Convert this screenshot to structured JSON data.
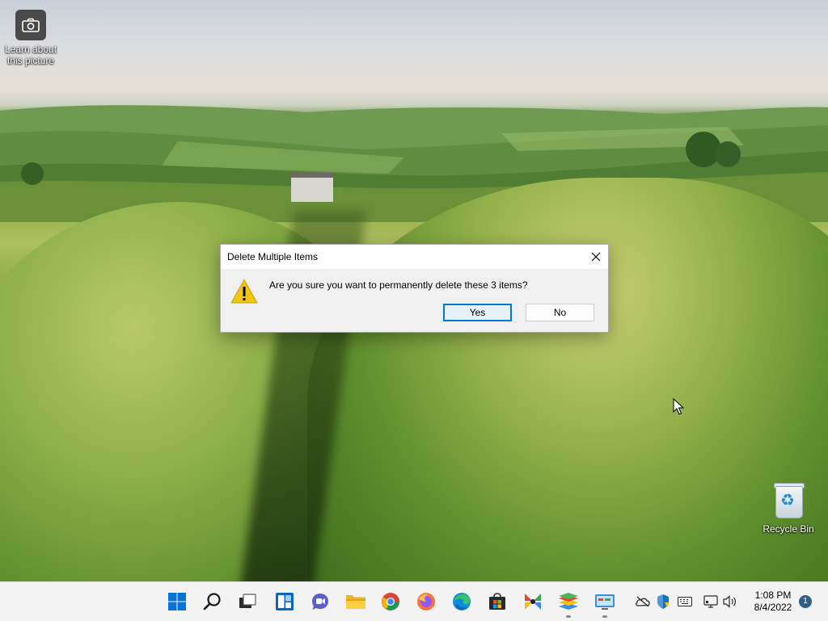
{
  "desktop": {
    "icons": [
      {
        "label": "Learn about this picture",
        "icon": "camera-icon"
      },
      {
        "label": "Recycle Bin",
        "icon": "recycle-bin-icon"
      }
    ]
  },
  "dialog": {
    "title": "Delete Multiple Items",
    "message": "Are you sure you want to permanently delete these 3 items?",
    "yes_label": "Yes",
    "no_label": "No",
    "icon": "warning-icon"
  },
  "taskbar": {
    "apps": [
      {
        "name": "Start",
        "icon": "windows-start-icon"
      },
      {
        "name": "Search",
        "icon": "search-icon"
      },
      {
        "name": "Task View",
        "icon": "task-view-icon"
      },
      {
        "name": "Widgets",
        "icon": "widgets-icon"
      },
      {
        "name": "Chat",
        "icon": "chat-icon"
      },
      {
        "name": "File Explorer",
        "icon": "file-explorer-icon"
      },
      {
        "name": "Chrome",
        "icon": "chrome-icon"
      },
      {
        "name": "Firefox",
        "icon": "firefox-icon"
      },
      {
        "name": "Edge",
        "icon": "edge-icon"
      },
      {
        "name": "Microsoft Store",
        "icon": "store-icon"
      },
      {
        "name": "App",
        "icon": "colorful-app-icon"
      },
      {
        "name": "BlueStacks",
        "icon": "bluestacks-icon"
      },
      {
        "name": "Control Panel",
        "icon": "control-panel-icon"
      }
    ],
    "tray": [
      "onedrive-icon",
      "security-icon",
      "keyboard-icon",
      "network-icon",
      "volume-icon"
    ],
    "time": "1:08 PM",
    "date": "8/4/2022",
    "notifications": "1"
  },
  "colors": {
    "accent": "#0078d7",
    "taskbar_bg": "#f3f3f3",
    "dialog_bg": "#f0f0f0",
    "warning": "#f2c511"
  }
}
